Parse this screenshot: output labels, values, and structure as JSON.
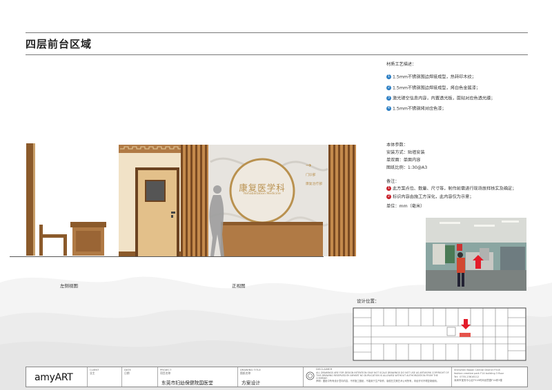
{
  "title": "四层前台区域",
  "materials": {
    "heading": "材质工艺描述：",
    "items": [
      {
        "n": "1",
        "text": "1.5mm不锈钢围边焊接成型，热转印木纹；"
      },
      {
        "n": "2",
        "text": "1.5mm不锈钢围边焊接成型，烤白色金属漆；"
      },
      {
        "n": "3",
        "text": "激光镂空信息内容，内置透光板，面贴对应色透光膜；"
      },
      {
        "n": "4",
        "text": "1.5mm不锈钢烤对应色漆；"
      }
    ]
  },
  "params": {
    "heading": "本体参数：",
    "install": "安装方式：贴墙安装",
    "sides": "单双面：单面内容",
    "scale": "图纸比例：1:30@A3"
  },
  "notes": {
    "heading": "备注：",
    "items": [
      {
        "n": "1",
        "text": "此方案点位、数量、尺寸等，制作前需进行现场放样核实及确定；"
      },
      {
        "n": "2",
        "text": "标识内容由施工方深化，此内容仅为示意；"
      }
    ],
    "unit": "单位：mm（毫米）"
  },
  "sign": {
    "cn": "康复医学科",
    "en": "Rehabilitation Medicine",
    "arrow": "→",
    "dir1": "门诊部",
    "dir2": "康复治疗部"
  },
  "labels": {
    "side": "左侧视图",
    "front": "正视图",
    "location": "设计位置："
  },
  "footer": {
    "logo": "amyART",
    "client_label": "CLIENT\n业主",
    "date_label": "DATE\n日期",
    "project_label": "PROJECT\n项目名称",
    "project": "东莞市妇幼保健院国医堂",
    "drawing_label": "DRAWING TITLE\n图纸名称",
    "drawing": "方案设计",
    "disclaimer_head": "DISCLAIMER",
    "disclaimer": "ALL DRAWINGS ARE FOR DESIGN INTENTION ONLY NOT SCALE DRAWINGS DO NOT USE AS ARTWORK COPYRIGHT OF THIS DRAWING RESERVED BY AMYART NO DUPLICATION IS ALLOWED WITHOUT AUTHORIZATION FROM THE COMPANY\n声明：图纸中所有设计意向内容，不作施工图纸，不能用于生产制作，版权归艾美艺术公司所有，未经许可不得复制使用。",
    "address": "Shenzhen Baoan Central District F518\nfashion creative park F14 building 3 floor\nTel：0755-23616112\n深圳市宝安中心区F518时尚创意园F14栋3楼"
  },
  "colors": {
    "wood": "#8b5a2b",
    "gold": "#b9914f",
    "wall": "#f1e2c7",
    "door": "#e3c08a"
  }
}
